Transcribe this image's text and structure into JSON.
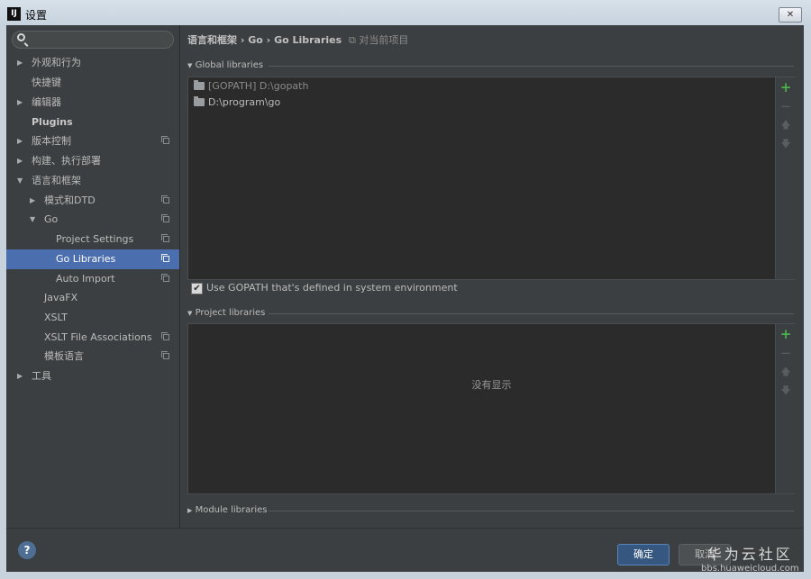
{
  "window": {
    "title": "设置",
    "app_icon": "IJ"
  },
  "search": {
    "placeholder": ""
  },
  "sidebar": {
    "items": [
      {
        "label": "外观和行为"
      },
      {
        "label": "快捷键"
      },
      {
        "label": "编辑器"
      },
      {
        "label": "Plugins"
      },
      {
        "label": "版本控制"
      },
      {
        "label": "构建、执行部署"
      },
      {
        "label": "语言和框架"
      },
      {
        "label": "模式和DTD"
      },
      {
        "label": "Go"
      },
      {
        "label": "Project Settings"
      },
      {
        "label": "Go Libraries"
      },
      {
        "label": "Auto Import"
      },
      {
        "label": "JavaFX"
      },
      {
        "label": "XSLT"
      },
      {
        "label": "XSLT File Associations"
      },
      {
        "label": "模板语言"
      },
      {
        "label": "工具"
      }
    ]
  },
  "breadcrumb": {
    "part1": "语言和框架",
    "sep": "›",
    "part2": "Go",
    "part3": "Go Libraries",
    "note": "对当前项目"
  },
  "global_libraries": {
    "title": "Global libraries",
    "items": [
      {
        "label": "[GOPATH] D:\\gopath",
        "color": "#8a8a8a"
      },
      {
        "label": "D:\\program\\go",
        "color": "#bbbbbb"
      }
    ]
  },
  "gopath_checkbox": {
    "label": "Use GOPATH that's defined in system environment",
    "checked": true
  },
  "project_libraries": {
    "title": "Project libraries",
    "empty_text": "没有显示"
  },
  "module_libraries": {
    "title": "Module libraries"
  },
  "buttons": {
    "ok": "确定",
    "cancel": "取消",
    "help": "?"
  },
  "watermark": {
    "line1": "华为云社区",
    "line2": "bbs.huaweicloud.com"
  },
  "colors": {
    "selected": "#4b6eaf",
    "add": "#4ab04a",
    "panel": "#2b2b2b",
    "background": "#3c3f41"
  }
}
